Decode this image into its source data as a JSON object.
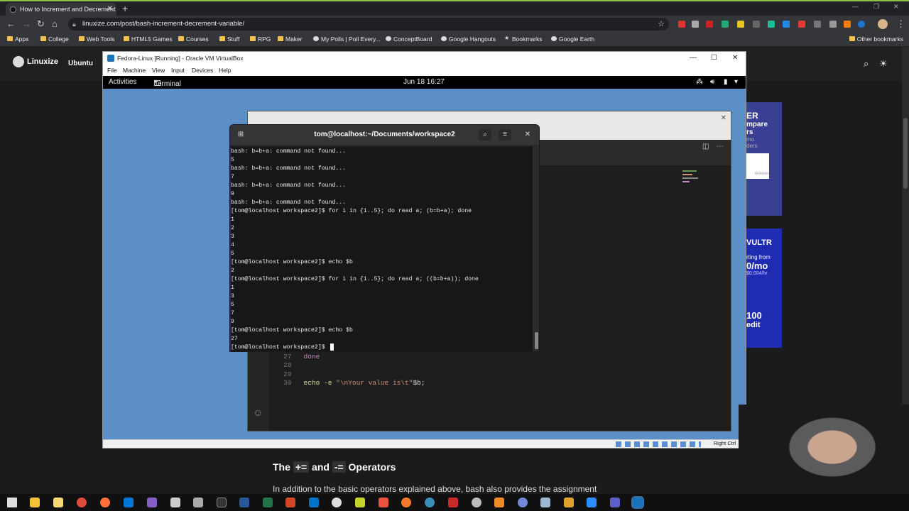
{
  "browser": {
    "tab_title": "How to Increment and Decrement",
    "url": "linuxize.com/post/bash-increment-decrement-variable/",
    "bookmarks": [
      "Apps",
      "College",
      "Web Tools",
      "HTML5 Games",
      "Courses",
      "Stuff",
      "RPG",
      "Maker",
      "My Polls | Poll Every...",
      "ConceptBoard",
      "Google Hangouts",
      "Bookmarks",
      "Google Earth"
    ],
    "other_bookmarks": "Other bookmarks"
  },
  "site": {
    "logo": "Linuxize",
    "nav_first": "Ubuntu",
    "article_heading_pre": "The",
    "op_plus": "+=",
    "and": "and",
    "op_minus": "-=",
    "article_heading_post": "Operators",
    "article_paragraph": "In addition to the basic operators explained above, bash also provides the assignment",
    "ads": {
      "top_lines": [
        "ER",
        "mpare",
        "rs",
        "mo",
        "ders"
      ],
      "mid": "reviews",
      "vultr": "VULTR",
      "vultr_from": "rting from",
      "vultr_price": "0/mo",
      "vultr_hr": "$0.004/hr",
      "vultr_credit_amount": "100",
      "vultr_credit": "edit"
    }
  },
  "vbox": {
    "title": "Fedora-Linux [Running] - Oracle VM VirtualBox",
    "menu": [
      "File",
      "Machine",
      "View",
      "Input",
      "Devices",
      "Help"
    ],
    "status_right": "Right Ctrl"
  },
  "gnome": {
    "activities": "Activities",
    "app": "Terminal",
    "clock": "Jun 18  16:27"
  },
  "editor": {
    "lines": [
      {
        "n": "26",
        "code": ""
      },
      {
        "n": "27",
        "code": "done"
      },
      {
        "n": "28",
        "code": ""
      },
      {
        "n": "29",
        "code": ""
      },
      {
        "n": "30",
        "code_a": "echo -e ",
        "code_b": "\"\\nYour value is\\t\"",
        "code_c": "$b;"
      }
    ]
  },
  "terminal": {
    "title": "tom@localhost:~/Documents/workspace2",
    "lines": [
      "bash: b=b+a: command not found...",
      "5",
      "bash: b=b+a: command not found...",
      "7",
      "bash: b=b+a: command not found...",
      "9",
      "bash: b=b+a: command not found...",
      "[tom@localhost workspace2]$ for i in {1..5}; do read a; (b=b+a); done",
      "1",
      "2",
      "3",
      "4",
      "5",
      "[tom@localhost workspace2]$ echo $b",
      "2",
      "[tom@localhost workspace2]$ for i in {1..5}; do read a; ((b=b+a)); done",
      "1",
      "3",
      "5",
      "7",
      "9",
      "[tom@localhost workspace2]$ echo $b",
      "27"
    ],
    "prompt": "[tom@localhost workspace2]$ "
  },
  "icons": {
    "search": "search-icon",
    "menu": "hamburger-menu-icon",
    "close": "close-icon",
    "new_tab": "new-tab-icon"
  }
}
